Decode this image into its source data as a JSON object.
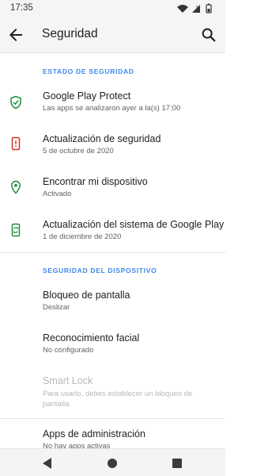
{
  "status_bar": {
    "time": "17:35"
  },
  "toolbar": {
    "title": "Seguridad",
    "back_icon": "arrow-back-icon",
    "search_icon": "search-icon"
  },
  "sections": {
    "security_status": {
      "header": "ESTADO DE SEGURIDAD",
      "items": [
        {
          "title": "Google Play Protect",
          "subtitle": "Las apps se analizaron ayer a la(s) 17:00",
          "icon": "shield-check-icon",
          "icon_color": "#1e8e3e"
        },
        {
          "title": "Actualización de seguridad",
          "subtitle": "5 de octubre de 2020",
          "icon": "phone-alert-icon",
          "icon_color": "#d93025"
        },
        {
          "title": "Encontrar mi dispositivo",
          "subtitle": "Activado",
          "icon": "location-pin-icon",
          "icon_color": "#1e8e3e"
        },
        {
          "title": "Actualización del sistema de Google Play",
          "subtitle": "1 de diciembre de 2020",
          "icon": "system-update-icon",
          "icon_color": "#1e8e3e"
        }
      ]
    },
    "device_security": {
      "header": "SEGURIDAD DEL DISPOSITIVO",
      "items": [
        {
          "title": "Bloqueo de pantalla",
          "subtitle": "Deslizar"
        },
        {
          "title": "Reconocimiento facial",
          "subtitle": "No configurado"
        },
        {
          "title": "Smart Lock",
          "subtitle": "Para usarlo, debes establecer un bloqueo de pantalla."
        },
        {
          "title": "Apps de administración",
          "subtitle": "No hay apps activas"
        }
      ]
    }
  },
  "colors": {
    "accent": "#1a73e8",
    "background": "#ffffff",
    "bar_background": "#f5f5f5"
  }
}
